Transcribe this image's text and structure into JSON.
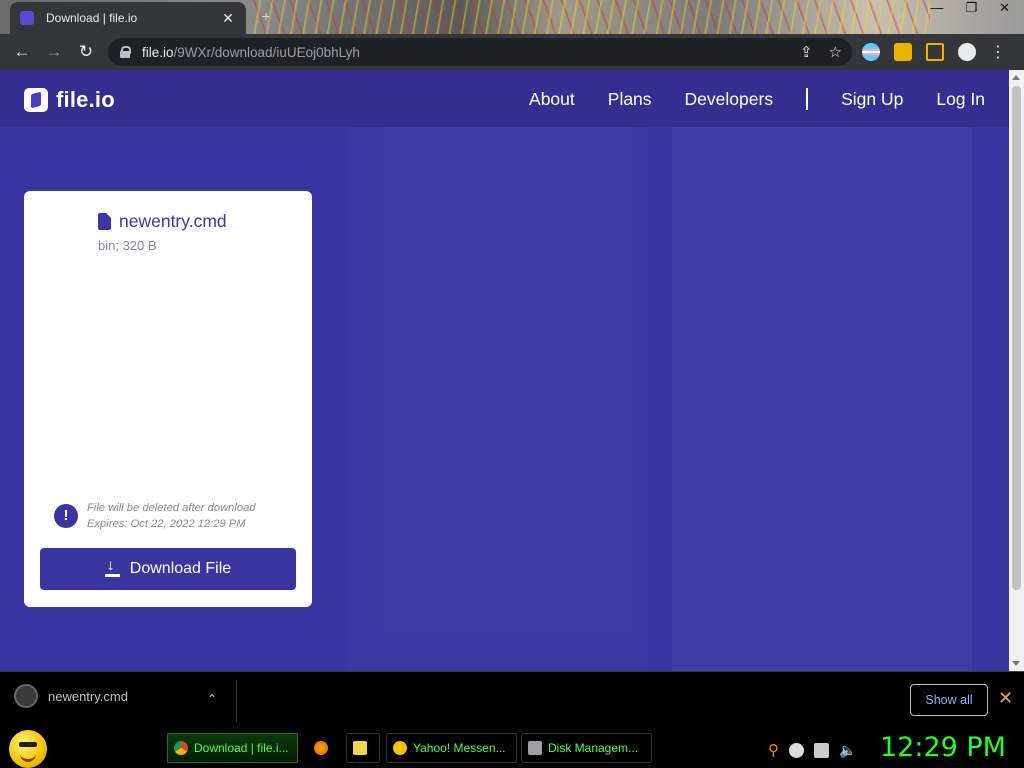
{
  "browser": {
    "tab_title": "Download | file.io",
    "url_host": "file.io",
    "url_path": "/9WXr/download/iuUEoj0bhLyh"
  },
  "site": {
    "logo_text": "file.io",
    "nav": [
      "About",
      "Plans",
      "Developers",
      "Sign Up",
      "Log In"
    ]
  },
  "file_card": {
    "file_name": "newentry.cmd",
    "file_meta": "bin; 320 B",
    "notice_line1": "File will be deleted after download",
    "notice_line2": "Expires: Oct 22, 2022 12:29 PM",
    "download_label": "Download File"
  },
  "download_shelf": {
    "file_name": "newentry.cmd",
    "show_all_label": "Show all"
  },
  "taskbar": {
    "items": [
      "Download | file.i...",
      "Yahoo! Messen...",
      "Disk Managem..."
    ],
    "clock": "12:29 PM"
  },
  "colors": {
    "page_bg": "#3a35a0",
    "nav_bg": "#332e8f",
    "button_bg": "#3a35a0",
    "taskbar_text": "#4cff4c"
  }
}
